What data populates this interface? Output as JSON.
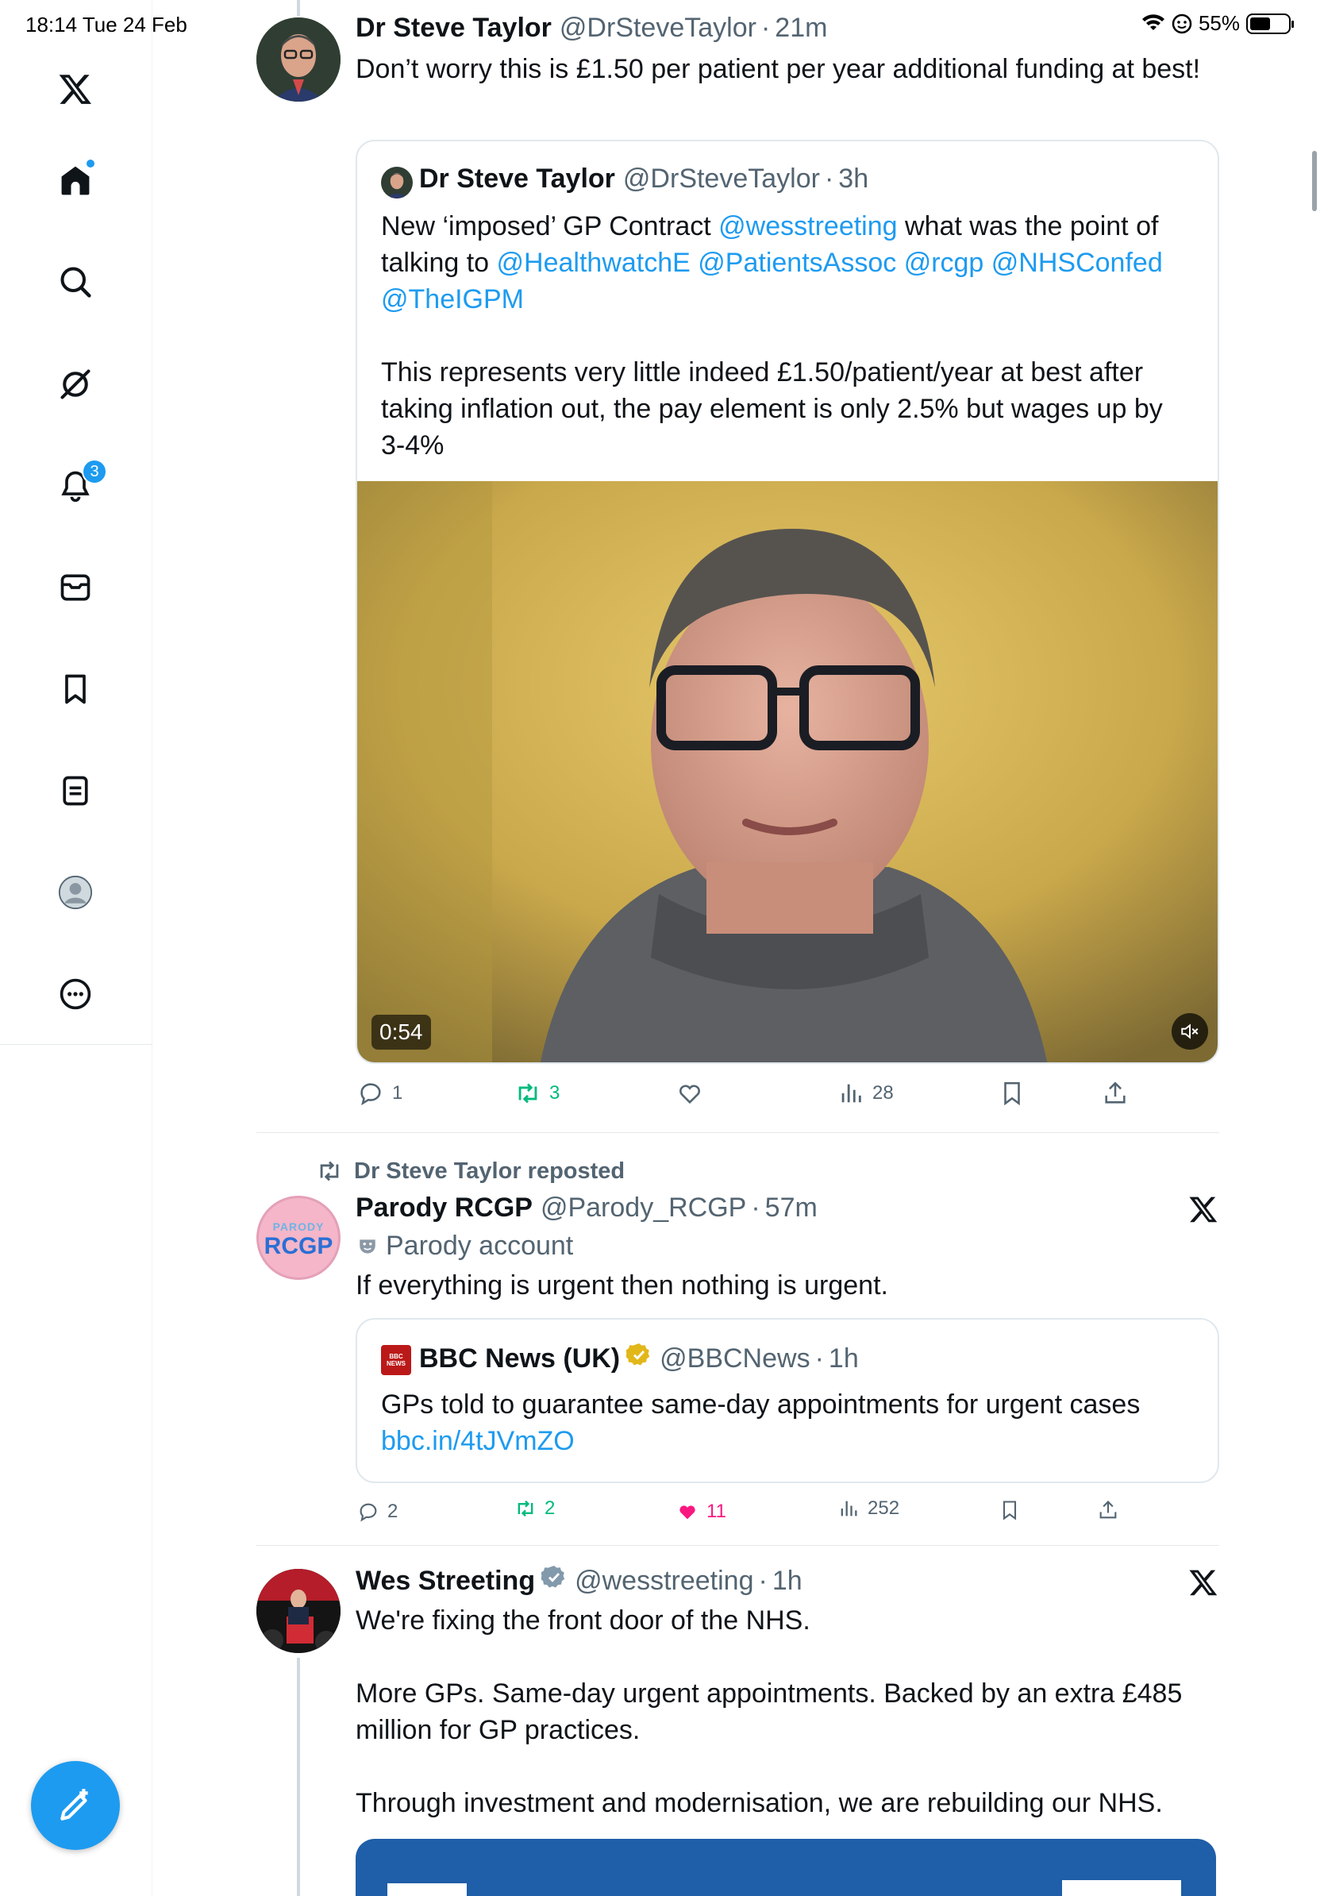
{
  "status_bar": {
    "time_date": "18:14  Tue 24 Feb",
    "battery": "55%",
    "battery_level": 0.55
  },
  "sidebar": {
    "items": [
      {
        "name": "home",
        "icon": "home-icon"
      },
      {
        "name": "search",
        "icon": "search-icon"
      },
      {
        "name": "grok",
        "icon": "grok-icon"
      },
      {
        "name": "notifications",
        "icon": "bell-icon",
        "badge": "3"
      },
      {
        "name": "messages",
        "icon": "mail-icon"
      },
      {
        "name": "bookmarks",
        "icon": "bookmark-icon"
      },
      {
        "name": "lists",
        "icon": "list-icon"
      },
      {
        "name": "profile",
        "icon": "profile-icon"
      },
      {
        "name": "more",
        "icon": "more-icon"
      }
    ],
    "compose_icon": "compose-icon"
  },
  "tweet1": {
    "name": "Dr Steve Taylor",
    "handle": "@DrSteveTaylor",
    "time": "21m",
    "text": "Don’t worry this is £1.50 per patient per year additional funding at best!",
    "quote": {
      "name": "Dr Steve Taylor",
      "handle": "@DrSteveTaylor",
      "time": "3h",
      "text_before": "New ‘imposed’ GP Contract ",
      "mention1": "@wesstreeting",
      "text_mid": " what was the point of talking to ",
      "mention2": "@HealthwatchE",
      "mention3": "@PatientsAssoc",
      "mention4": "@rcgp",
      "mention5": "@NHSConfed",
      "mention6": "@TheIGPM",
      "text_after": "This represents very little indeed £1.50/patient/year at best after taking inflation out, the pay element is only 2.5% but wages up by 3-4%",
      "video_duration": "0:54"
    },
    "replies": "1",
    "reposts": "3",
    "likes": "",
    "views": "28"
  },
  "tweet2": {
    "repost_label": "Dr Steve Taylor reposted",
    "name": "Parody RCGP",
    "handle": "@Parody_RCGP",
    "time": "57m",
    "parody_label": "Parody account",
    "avatar_top": "PARODY",
    "avatar_main": "RCGP",
    "text": "If everything is urgent then nothing is urgent.",
    "quote": {
      "name": "BBC News (UK)",
      "handle": "@BBCNews",
      "time": "1h",
      "logo_text": "BBC NEWS",
      "text": "GPs told to guarantee same-day appointments for urgent cases",
      "link": "bbc.in/4tJVmZO"
    },
    "replies": "2",
    "reposts": "2",
    "likes": "11",
    "views": "252"
  },
  "tweet3": {
    "name": "Wes Streeting",
    "handle": "@wesstreeting",
    "time": "1h",
    "p1": "We're fixing the front door of the NHS.",
    "p2": "More GPs. Same-day urgent appointments. Backed by an extra £485 million for GP practices.",
    "p3": "Through investment and modernisation, we are rebuilding our NHS."
  },
  "colors": {
    "accent": "#1d9bf0",
    "repost": "#00ba7c",
    "like": "#f91880",
    "text": "#0f1419",
    "muted": "#536471",
    "nhs_blue": "#005eb8"
  }
}
